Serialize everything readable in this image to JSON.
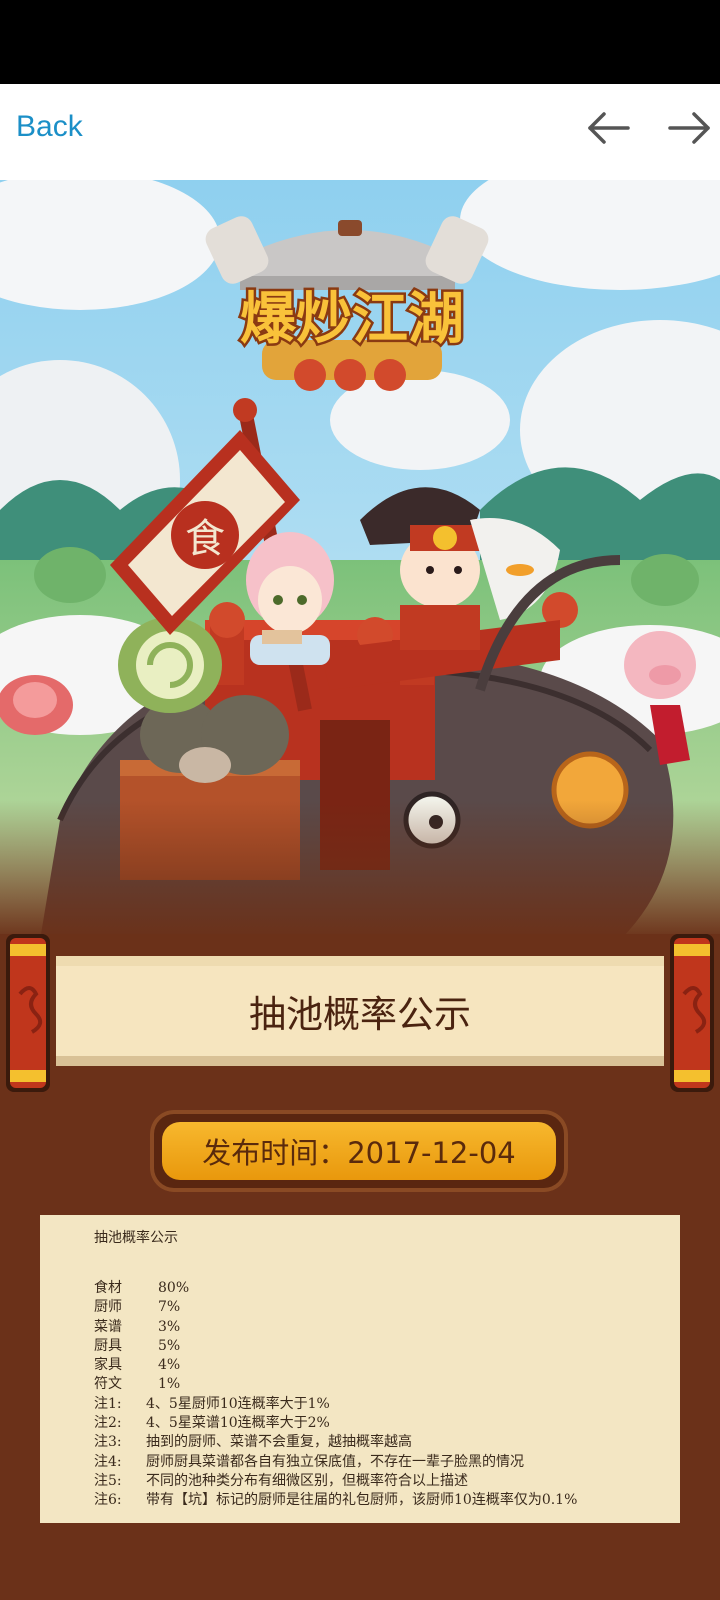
{
  "nav": {
    "back_label": "Back",
    "back_icon": "arrow-left-icon",
    "forward_icon": "arrow-right-icon"
  },
  "banner": {
    "logo_text": "爆炒江湖",
    "flag_char": "食"
  },
  "section_title": "抽池概率公示",
  "publish_date": "发布时间：2017-12-04",
  "notice": {
    "heading": "抽池概率公示",
    "rates": [
      {
        "label": "食材",
        "value": "80%"
      },
      {
        "label": "厨师",
        "value": "7%"
      },
      {
        "label": "菜谱",
        "value": "3%"
      },
      {
        "label": "厨具",
        "value": "5%"
      },
      {
        "label": "家具",
        "value": "4%"
      },
      {
        "label": "符文",
        "value": "1%"
      }
    ],
    "notes": [
      {
        "label": "注1:",
        "text": "4、5星厨师10连概率大于1%"
      },
      {
        "label": "注2:",
        "text": "4、5星菜谱10连概率大于2%"
      },
      {
        "label": "注3:",
        "text": "抽到的厨师、菜谱不会重复，越抽概率越高"
      },
      {
        "label": "注4:",
        "text": "厨师厨具菜谱都各自有独立保底值，不存在一辈子脸黑的情况"
      },
      {
        "label": "注5:",
        "text": "不同的池种类分布有细微区别，但概率符合以上描述"
      },
      {
        "label": "注6:",
        "text": "带有【坑】标记的厨师是往届的礼包厨师，该厨师10连概率仅为0.1%"
      }
    ]
  },
  "colors": {
    "accent_blue": "#1b8fc7",
    "page_brown": "#6b3119",
    "date_gold": "#f0a81c",
    "panel_cream": "#f3e6c3"
  }
}
